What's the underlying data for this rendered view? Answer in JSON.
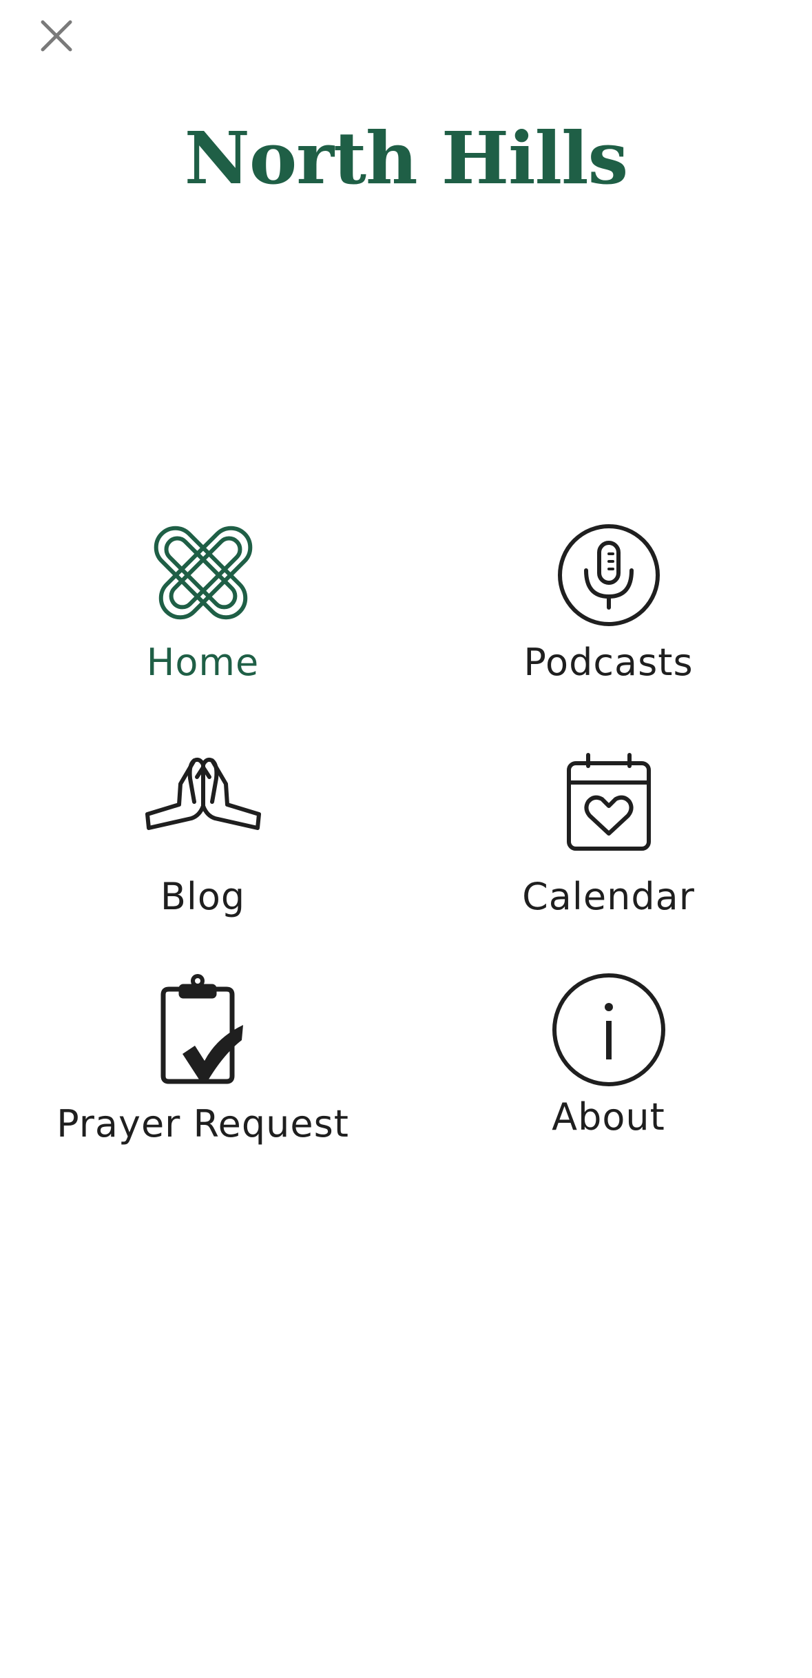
{
  "app": {
    "title": "North Hills",
    "brand_color": "#1f5f46",
    "text_color": "#1f1f1f"
  },
  "header": {
    "close_icon": "close-icon"
  },
  "menu": {
    "items": [
      {
        "label": "Home",
        "icon": "celtic-knot-icon",
        "active": true
      },
      {
        "label": "Podcasts",
        "icon": "microphone-icon",
        "active": false
      },
      {
        "label": "Blog",
        "icon": "praying-hands-icon",
        "active": false
      },
      {
        "label": "Calendar",
        "icon": "calendar-heart-icon",
        "active": false
      },
      {
        "label": "Prayer Request",
        "icon": "clipboard-check-icon",
        "active": false
      },
      {
        "label": "About",
        "icon": "info-icon",
        "active": false
      }
    ]
  }
}
